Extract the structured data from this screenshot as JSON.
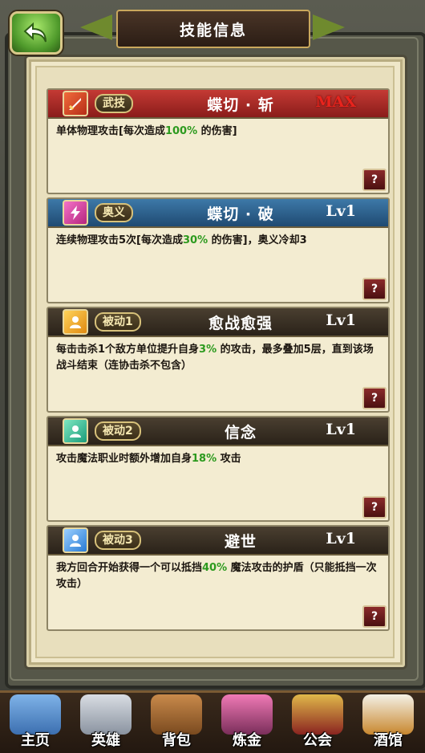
{
  "header": {
    "back_label": "",
    "title": "技能信息"
  },
  "skills": [
    {
      "type": "武技",
      "name": "蝶切 · 斩",
      "level": "MAX",
      "desc_parts": [
        "单体物理攻击[每次造成",
        "100%",
        " 的伤害]"
      ],
      "help": "?"
    },
    {
      "type": "奥义",
      "name": "蝶切 · 破",
      "level": "Lv1",
      "desc_parts": [
        "连续物理攻击5次[每次造成",
        "30%",
        " 的伤害]，奥义冷却3"
      ],
      "help": "?"
    },
    {
      "type": "被动1",
      "name": "愈战愈强",
      "level": "Lv1",
      "desc_parts": [
        "每击击杀1个敌方单位提升自身",
        "3%",
        " 的攻击，最多叠加5层，直到该场战斗结束（连协击杀不包含）"
      ],
      "help": "?"
    },
    {
      "type": "被动2",
      "name": "信念",
      "level": "Lv1",
      "desc_parts": [
        "攻击魔法职业时额外增加自身",
        "18%",
        " 攻击"
      ],
      "help": "?"
    },
    {
      "type": "被动3",
      "name": "避世",
      "level": "Lv1",
      "desc_parts": [
        "我方回合开始获得一个可以抵挡",
        "40%",
        " 魔法攻击的护盾（只能抵挡一次攻击）"
      ],
      "help": "?"
    }
  ],
  "nav": [
    {
      "label": "主页"
    },
    {
      "label": "英雄"
    },
    {
      "label": "背包"
    },
    {
      "label": "炼金"
    },
    {
      "label": "公会"
    },
    {
      "label": "酒馆"
    }
  ],
  "colors": {
    "highlight": "#2c9a1e",
    "max_level": "#e8241d"
  }
}
